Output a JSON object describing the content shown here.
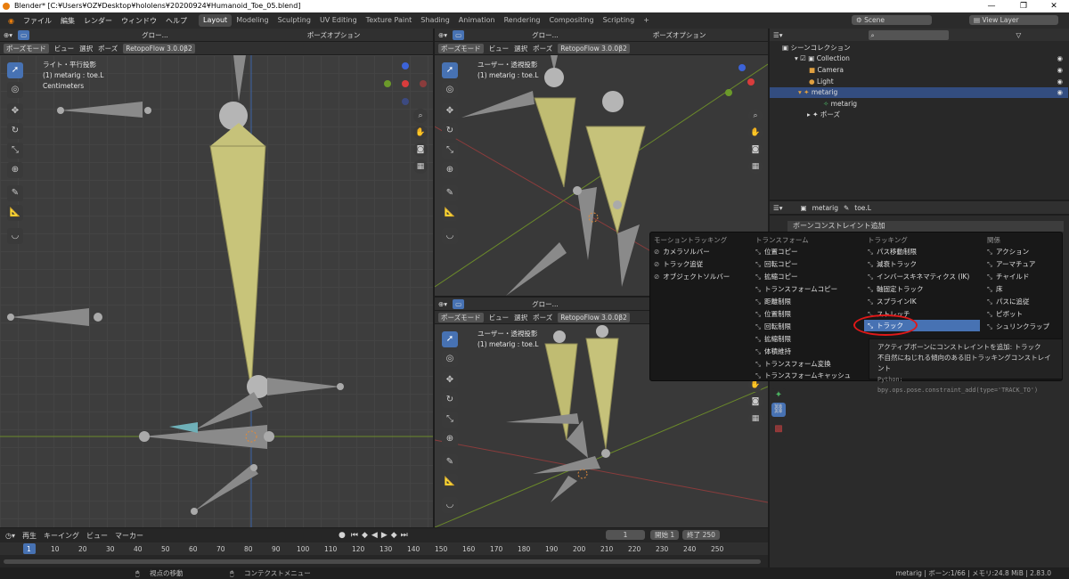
{
  "title_bar": {
    "title": "Blender* [C:¥Users¥OZ¥Desktop¥hololens¥20200924¥Humanoid_Toe_05.blend]",
    "min": "—",
    "max": "❐",
    "close": "✕"
  },
  "menubar": {
    "items": [
      "ファイル",
      "編集",
      "レンダー",
      "ウィンドウ",
      "ヘルプ"
    ],
    "workspaces": [
      "Layout",
      "Modeling",
      "Sculpting",
      "UV Editing",
      "Texture Paint",
      "Shading",
      "Animation",
      "Rendering",
      "Compositing",
      "Scripting"
    ],
    "add_tab": "+",
    "scene_label": "Scene",
    "view_layer_label": "View Layer"
  },
  "viewport_header": {
    "transform": "グロー...",
    "pose_options": "ポーズオプション",
    "mode": "ポーズモード",
    "view": "ビュー",
    "select": "選択",
    "pose": "ポーズ",
    "addon": "RetopoFlow 3.0.0β2"
  },
  "viewport_left": {
    "projection": "ライト・平行投影",
    "object": "(1) metarig : toe.L",
    "units": "Centimeters"
  },
  "viewport_top_right": {
    "projection": "ユーザー・透視投影",
    "object": "(1) metarig : toe.L"
  },
  "viewport_bottom_right": {
    "projection": "ユーザー・透視投影",
    "object": "(1) metarig : toe.L"
  },
  "outliner": {
    "search_placeholder": "",
    "items": [
      {
        "label": "シーンコレクション"
      },
      {
        "label": "Collection"
      },
      {
        "label": "Camera"
      },
      {
        "label": "Light"
      },
      {
        "label": "metarig"
      },
      {
        "label": "metarig"
      },
      {
        "label": "ポーズ"
      }
    ]
  },
  "properties": {
    "object": "metarig",
    "bone": "toe.L",
    "panel_title": "ボーンコンストレイント追加"
  },
  "constraint_menu": {
    "headers": [
      "モーショントラッキング",
      "トランスフォーム",
      "トラッキング",
      "関係"
    ],
    "motion_tracking": [
      "カメラソルバー",
      "トラック追従",
      "オブジェクトソルバー"
    ],
    "transform": [
      "位置コピー",
      "回転コピー",
      "拡縮コピー",
      "トランスフォームコピー",
      "距離制限",
      "位置制限",
      "回転制限",
      "拡縮制限",
      "体積維持",
      "トランスフォーム変換",
      "トランスフォームキャッシュ"
    ],
    "tracking": [
      "パス移動制限",
      "減衰トラック",
      "インバースキネマティクス (IK)",
      "軸固定トラック",
      "スプラインIK",
      "ストレッチ",
      "トラック"
    ],
    "relationship": [
      "アクション",
      "アーマチュア",
      "チャイルド",
      "床",
      "パスに追従",
      "ピボット",
      "シュリンクラップ"
    ]
  },
  "tooltip": {
    "line1": "アクティブボーンにコンストレイントを追加: トラック",
    "line2": "不自然にねじれる傾向のある旧トラッキングコンストレイント",
    "python": "Python: bpy.ops.pose.constraint_add(type='TRACK_TO')"
  },
  "timeline": {
    "playback": "再生",
    "keying": "キーイング",
    "view": "ビュー",
    "marker": "マーカー",
    "current_frame": "1",
    "start_label": "開始",
    "start": "1",
    "end_label": "終了",
    "end": "250",
    "frames": [
      "1",
      "10",
      "20",
      "30",
      "40",
      "50",
      "60",
      "70",
      "80",
      "90",
      "100",
      "110",
      "120",
      "130",
      "140",
      "150",
      "160",
      "170",
      "180",
      "190",
      "200",
      "210",
      "220",
      "230",
      "240",
      "250"
    ]
  },
  "statusbar": {
    "left": "視点の移動",
    "middle": "コンテクストメニュー",
    "right": "metarig | ボーン:1/66 | メモリ:24.8 MiB | 2.83.0"
  }
}
